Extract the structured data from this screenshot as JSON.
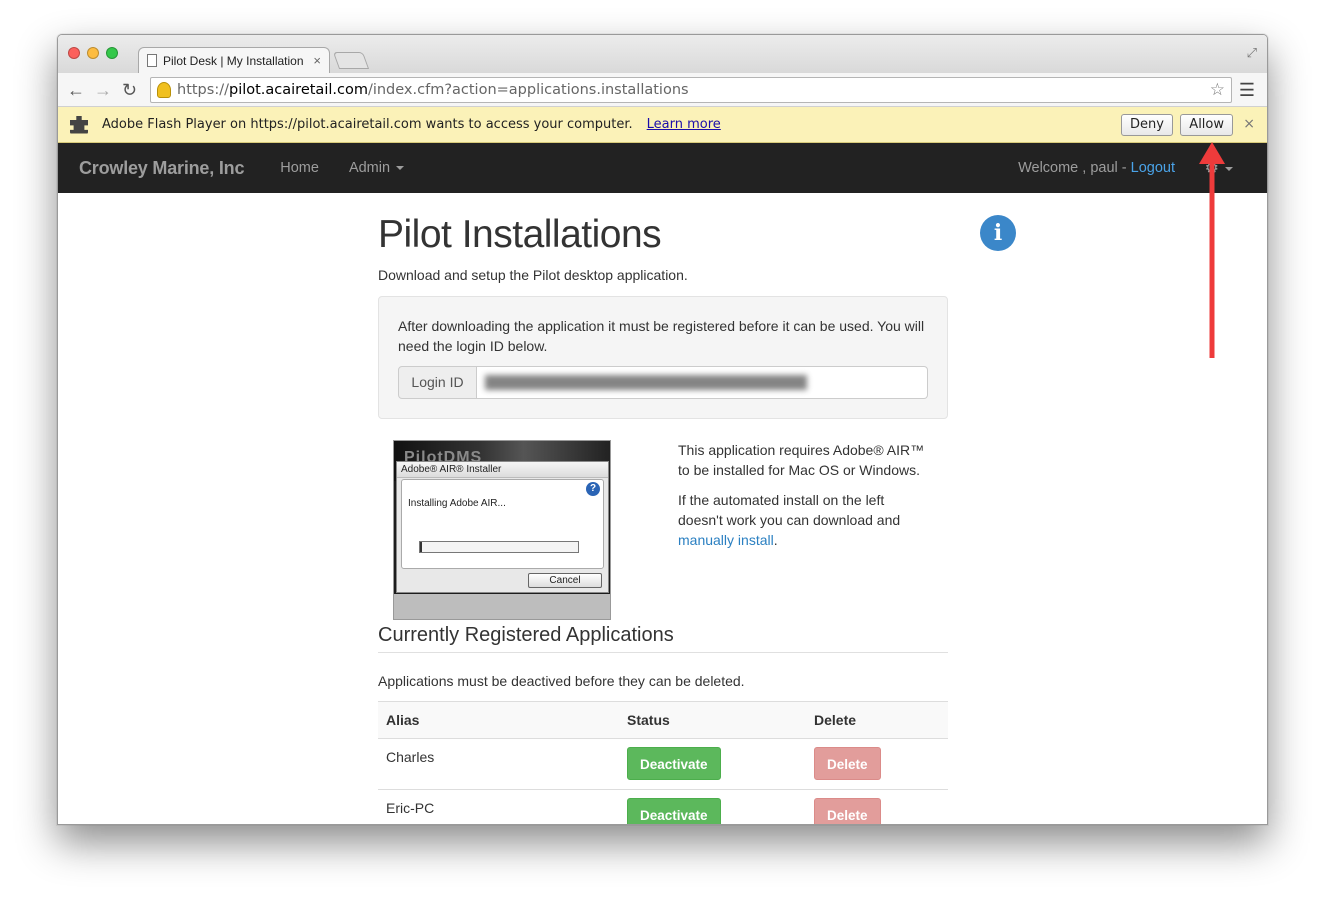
{
  "browser": {
    "tab_title": "Pilot Desk | My Installation",
    "tab_close": "×",
    "url_scheme": "https://",
    "url_host": "pilot.acairetail.com",
    "url_path": "/index.cfm?action=applications.installations"
  },
  "infobar": {
    "message": "Adobe Flash Player on https://pilot.acairetail.com wants to access your computer.",
    "learn_more": "Learn more",
    "deny": "Deny",
    "allow": "Allow",
    "close": "×"
  },
  "navbar": {
    "brand": "Crowley Marine, Inc",
    "home": "Home",
    "admin": "Admin",
    "welcome": "Welcome , paul - ",
    "logout": "Logout"
  },
  "page": {
    "title": "Pilot Installations",
    "lead": "Download and setup the Pilot desktop application.",
    "well_text": "After downloading the application it must be registered before it can be used. You will need the login ID below.",
    "login_label": "Login ID",
    "login_value": ""
  },
  "installer": {
    "backdrop": "PilotDMS",
    "title": "Adobe® AIR® Installer",
    "status": "Installing Adobe AIR...",
    "cancel": "Cancel",
    "progress": 0.01
  },
  "side": {
    "p1": "This application requires Adobe® AIR™ to be installed for Mac OS or Windows.",
    "p2_prefix": "If the automated install on the left doesn't work you can download and ",
    "p2_link": "manually install",
    "p2_suffix": "."
  },
  "registered": {
    "heading": "Currently Registered Applications",
    "note": "Applications must be deactived before they can be deleted.",
    "columns": [
      "Alias",
      "Status",
      "Delete"
    ],
    "rows": [
      {
        "alias": "Charles",
        "status": "Deactivate",
        "delete": "Delete"
      },
      {
        "alias": "Eric-PC",
        "status": "Deactivate",
        "delete": "Delete"
      }
    ]
  },
  "colors": {
    "navbar": "#222222",
    "infobar": "#fbf2b8",
    "deactivate": "#5cb85c",
    "delete": "#e29d9b",
    "arrow": "#ee3b3b",
    "info_icon": "#3b87c9"
  }
}
